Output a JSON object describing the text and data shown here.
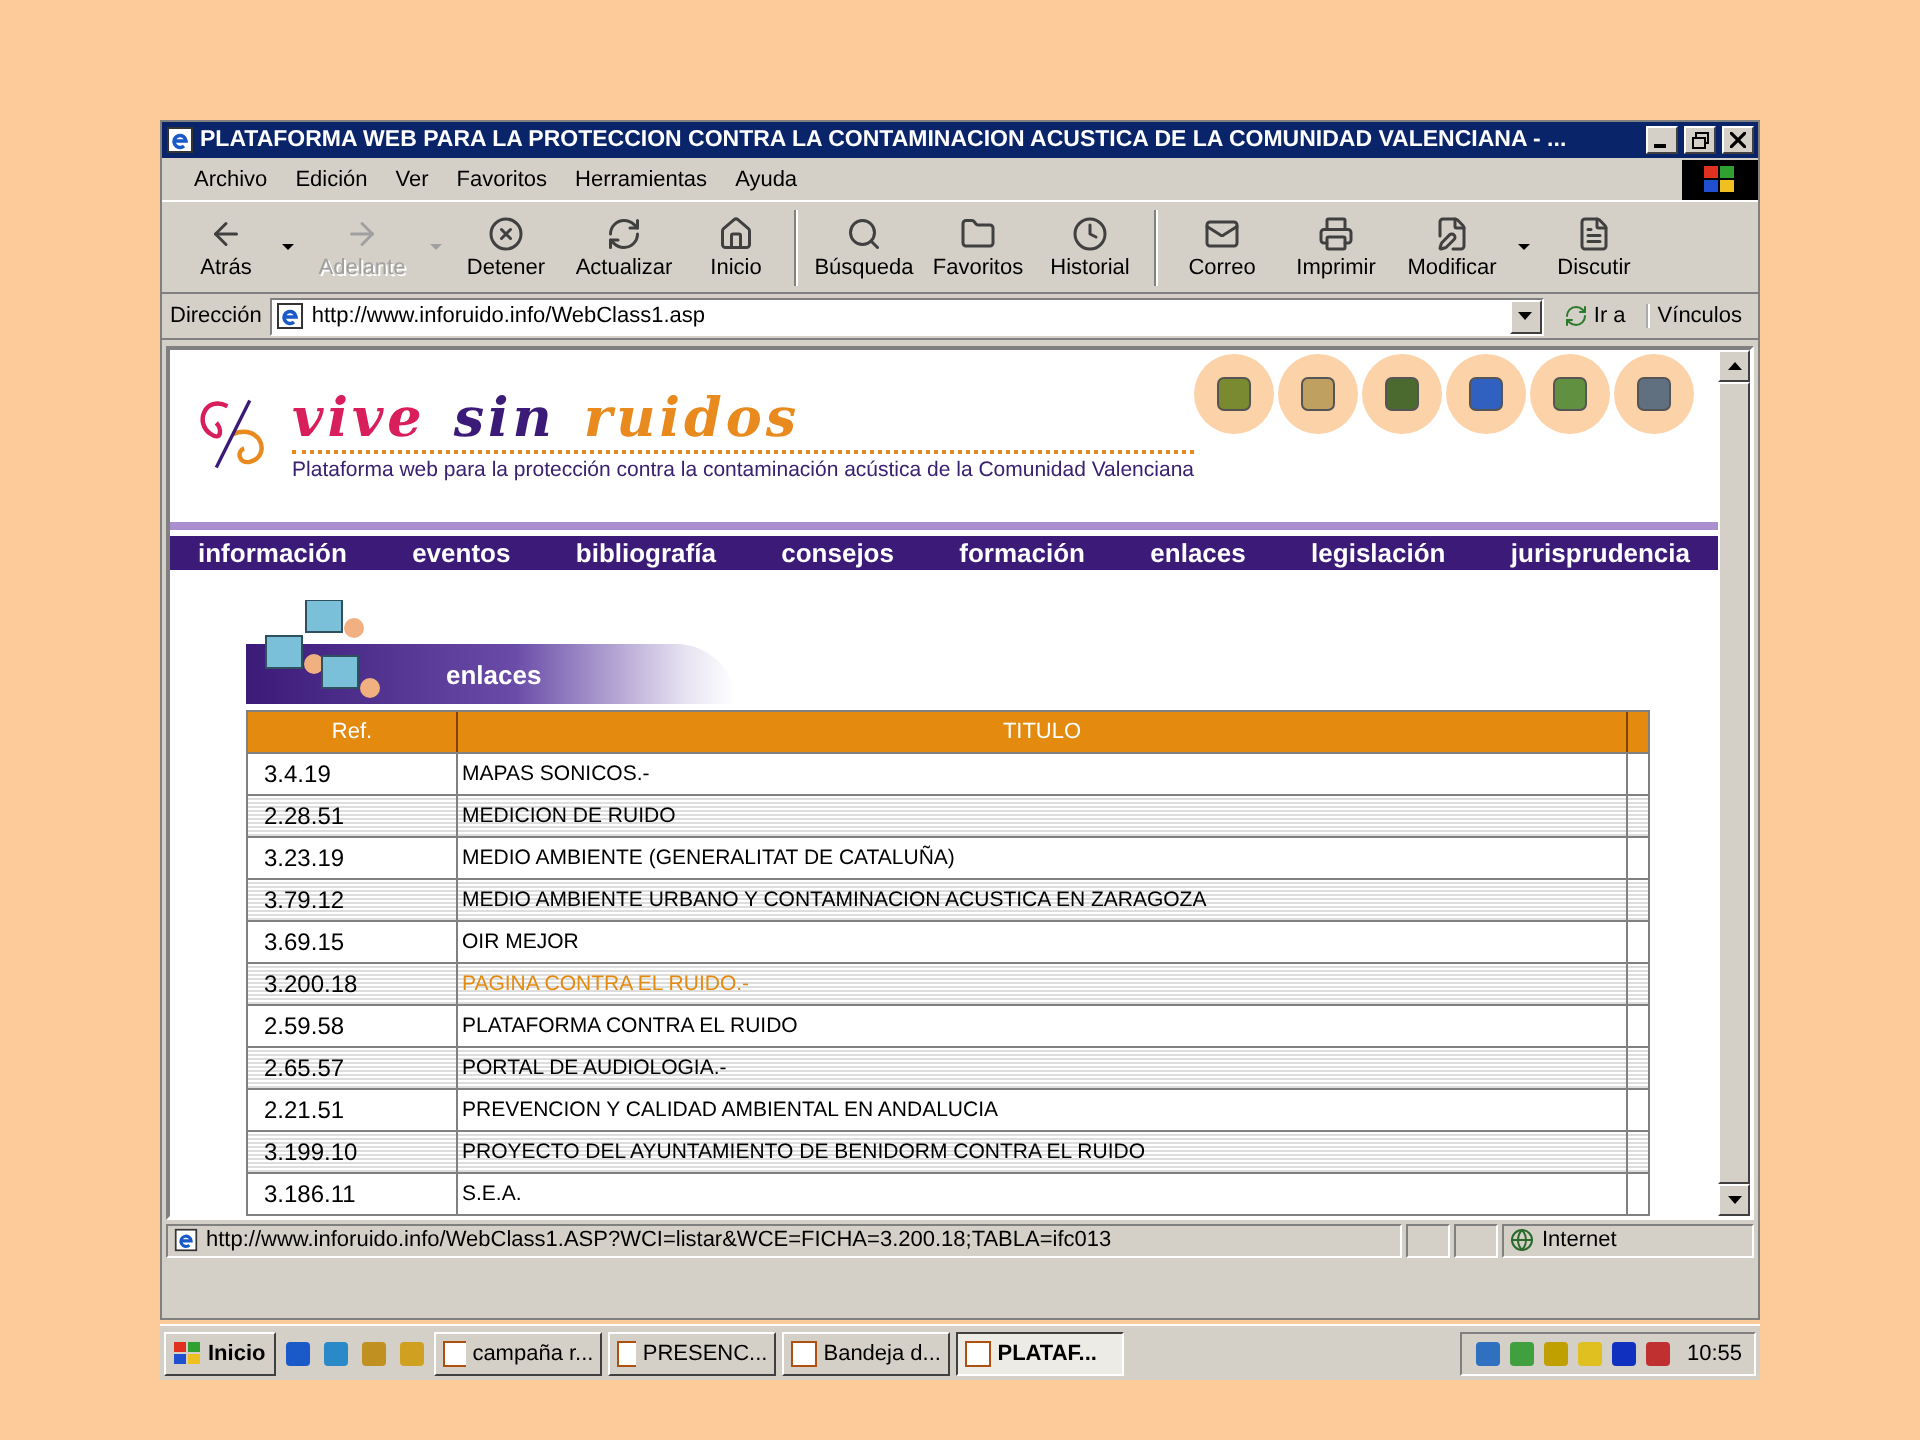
{
  "window": {
    "title": "PLATAFORMA WEB PARA LA PROTECCION CONTRA LA CONTAMINACION ACUSTICA DE LA COMUNIDAD VALENCIANA - ..."
  },
  "menu": [
    "Archivo",
    "Edición",
    "Ver",
    "Favoritos",
    "Herramientas",
    "Ayuda"
  ],
  "toolbar": [
    {
      "label": "Atrás",
      "disabled": false,
      "dropdown": true,
      "separator_before": false
    },
    {
      "label": "Adelante",
      "disabled": true,
      "dropdown": true,
      "separator_before": false
    },
    {
      "label": "Detener",
      "disabled": false,
      "dropdown": false,
      "separator_before": false
    },
    {
      "label": "Actualizar",
      "disabled": false,
      "dropdown": false,
      "separator_before": false
    },
    {
      "label": "Inicio",
      "disabled": false,
      "dropdown": false,
      "separator_before": false
    },
    {
      "label": "Búsqueda",
      "disabled": false,
      "dropdown": false,
      "separator_before": true
    },
    {
      "label": "Favoritos",
      "disabled": false,
      "dropdown": false,
      "separator_before": false
    },
    {
      "label": "Historial",
      "disabled": false,
      "dropdown": false,
      "separator_before": false
    },
    {
      "label": "Correo",
      "disabled": false,
      "dropdown": false,
      "separator_before": true
    },
    {
      "label": "Imprimir",
      "disabled": false,
      "dropdown": false,
      "separator_before": false
    },
    {
      "label": "Modificar",
      "disabled": false,
      "dropdown": true,
      "separator_before": false
    },
    {
      "label": "Discutir",
      "disabled": false,
      "dropdown": false,
      "separator_before": false
    }
  ],
  "address": {
    "label": "Dirección",
    "value": "http://www.inforuido.info/WebClass1.asp",
    "go": "Ir a",
    "links": "Vínculos"
  },
  "site": {
    "logo_words": [
      "vive",
      "sin",
      "ruidos"
    ],
    "tagline": "Plataforma web para la protección contra la contaminación acústica de la Comunidad Valenciana",
    "nav": [
      "información",
      "eventos",
      "bibliografía",
      "consejos",
      "formación",
      "enlaces",
      "legislación",
      "jurisprudencia"
    ],
    "section": "enlaces"
  },
  "table": {
    "columns": [
      "Ref.",
      "TITULO"
    ],
    "rows": [
      {
        "ref": "3.4.19",
        "title": "MAPAS SONICOS.-",
        "highlighted": false
      },
      {
        "ref": "2.28.51",
        "title": "MEDICION DE RUIDO",
        "highlighted": false
      },
      {
        "ref": "3.23.19",
        "title": "MEDIO AMBIENTE (GENERALITAT DE CATALUÑA)",
        "highlighted": false
      },
      {
        "ref": "3.79.12",
        "title": "MEDIO AMBIENTE URBANO Y CONTAMINACION ACUSTICA EN ZARAGOZA",
        "highlighted": false
      },
      {
        "ref": "3.69.15",
        "title": "OIR MEJOR",
        "highlighted": false
      },
      {
        "ref": "3.200.18",
        "title": "PAGINA CONTRA EL RUIDO.-",
        "highlighted": true
      },
      {
        "ref": "2.59.58",
        "title": "PLATAFORMA CONTRA EL RUIDO",
        "highlighted": false
      },
      {
        "ref": "2.65.57",
        "title": "PORTAL DE AUDIOLOGIA.-",
        "highlighted": false
      },
      {
        "ref": "2.21.51",
        "title": "PREVENCION Y CALIDAD AMBIENTAL EN ANDALUCIA",
        "highlighted": false
      },
      {
        "ref": "3.199.10",
        "title": "PROYECTO DEL AYUNTAMIENTO DE BENIDORM CONTRA EL RUIDO",
        "highlighted": false
      },
      {
        "ref": "3.186.11",
        "title": "S.E.A.",
        "highlighted": false
      }
    ]
  },
  "status_bar": {
    "url": "http://www.inforuido.info/WebClass1.ASP?WCI=listar&WCE=FICHA=3.200.18;TABLA=ifc013",
    "zone": "Internet"
  },
  "taskbar": {
    "start": "Inicio",
    "tasks": [
      {
        "label": "campaña r...",
        "selected": false
      },
      {
        "label": "PRESENC...",
        "selected": false
      },
      {
        "label": "Bandeja d...",
        "selected": false
      },
      {
        "label": "PLATAF...",
        "selected": true
      }
    ],
    "clock": "10:55"
  }
}
